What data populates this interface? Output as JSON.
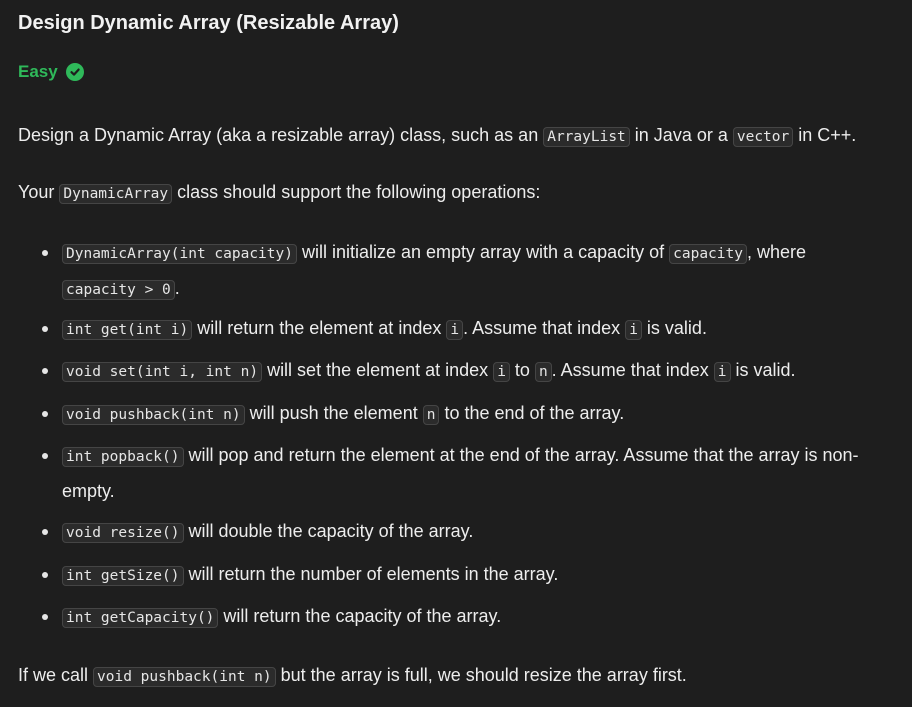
{
  "title": "Design Dynamic Array (Resizable Array)",
  "difficulty": "Easy",
  "colors": {
    "accent": "#2fb95a",
    "background": "#1e1e1e",
    "code_bg": "#2b2b2b"
  },
  "intro": {
    "t1": "Design a Dynamic Array (aka a resizable array) class, such as an ",
    "c1": "ArrayList",
    "t2": " in Java or a ",
    "c2": "vector",
    "t3": " in C++."
  },
  "support": {
    "t1": "Your ",
    "c1": "DynamicArray",
    "t2": " class should support the following operations:"
  },
  "ops": [
    {
      "c1": "DynamicArray(int capacity)",
      "t1": " will initialize an empty array with a capacity of ",
      "c2": "capacity",
      "t2": ", where ",
      "c3": "capacity > 0",
      "t3": "."
    },
    {
      "c1": "int get(int i)",
      "t1": " will return the element at index ",
      "c2": "i",
      "t2": ". Assume that index ",
      "c3": "i",
      "t3": " is valid."
    },
    {
      "c1": "void set(int i, int n)",
      "t1": " will set the element at index ",
      "c2": "i",
      "t2": " to ",
      "c3": "n",
      "t3": ". Assume that index ",
      "c4": "i",
      "t4": " is valid."
    },
    {
      "c1": "void pushback(int n)",
      "t1": " will push the element ",
      "c2": "n",
      "t2": " to the end of the array."
    },
    {
      "c1": "int popback()",
      "t1": " will pop and return the element at the end of the array. Assume that the array is non-empty."
    },
    {
      "c1": "void resize()",
      "t1": " will double the capacity of the array."
    },
    {
      "c1": "int getSize()",
      "t1": " will return the number of elements in the array."
    },
    {
      "c1": "int getCapacity()",
      "t1": " will return the capacity of the array."
    }
  ],
  "outro": {
    "t1": "If we call ",
    "c1": "void pushback(int n)",
    "t2": " but the array is full, we should resize the array first."
  },
  "icons": {
    "difficulty_badge": "check-circle-icon"
  }
}
